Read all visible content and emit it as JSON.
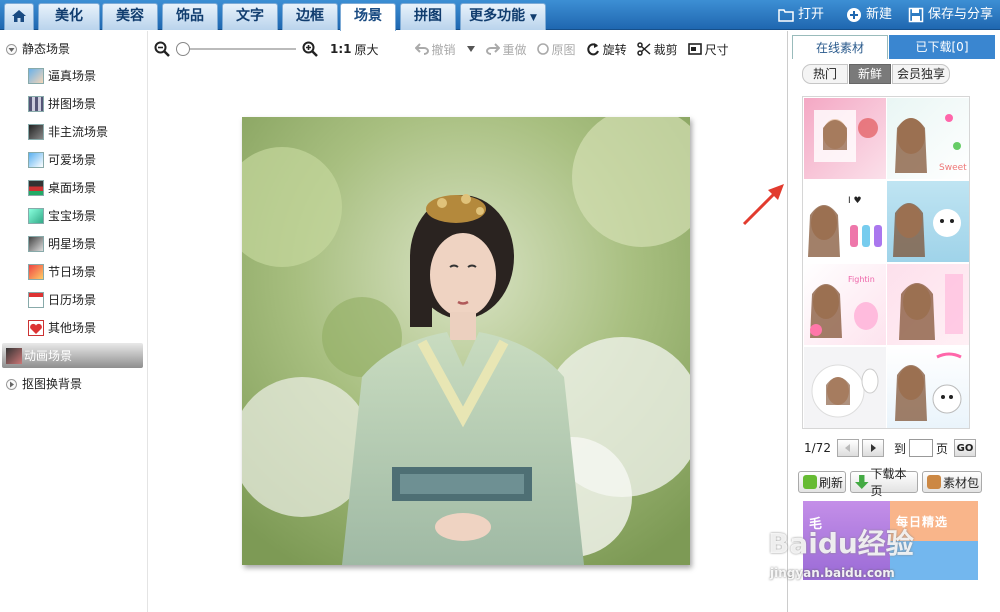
{
  "topbar": {
    "tabs": [
      "美化",
      "美容",
      "饰品",
      "文字",
      "边框",
      "场景",
      "拼图",
      "更多功能"
    ],
    "active_tab": "场景",
    "open_label": "打开",
    "new_label": "新建",
    "save_share_label": "保存与分享"
  },
  "sidebar": {
    "static_group": "静态场景",
    "items": [
      "逼真场景",
      "拼图场景",
      "非主流场景",
      "可爱场景",
      "桌面场景",
      "宝宝场景",
      "明星场景",
      "节日场景",
      "日历场景",
      "其他场景"
    ],
    "selected_item": "动画场景",
    "cutout_group": "抠图换背景"
  },
  "toolbar": {
    "ratio_label": "1:1",
    "original_size_label": "原大",
    "undo_label": "撤销",
    "redo_label": "重做",
    "original_label": "原图",
    "rotate_label": "旋转",
    "crop_label": "裁剪",
    "size_label": "尺寸",
    "zoom_level": 0
  },
  "right_panel": {
    "tab_online": "在线素材",
    "tab_downloaded": "已下载[0]",
    "sub_tabs": [
      "热门",
      "新鲜",
      "会员独享"
    ],
    "active_sub_tab": "新鲜",
    "page_indicator": "1/72",
    "goto_label": "到",
    "page_suffix": "页",
    "go_button": "GO",
    "refresh_label": "刷新",
    "download_page_label": "下载本页",
    "material_pack_label": "素材包",
    "banner_left": "毛",
    "banner_right": "每日精选"
  },
  "watermark": {
    "logo": "Baidu经验",
    "url": "jingyan.baidu.com"
  },
  "colors": {
    "topbar": "#2a78c3",
    "active_tab": "#ffffff",
    "right_tab_active": "#3a86d0",
    "annotation_arrow": "#e23b2e"
  }
}
